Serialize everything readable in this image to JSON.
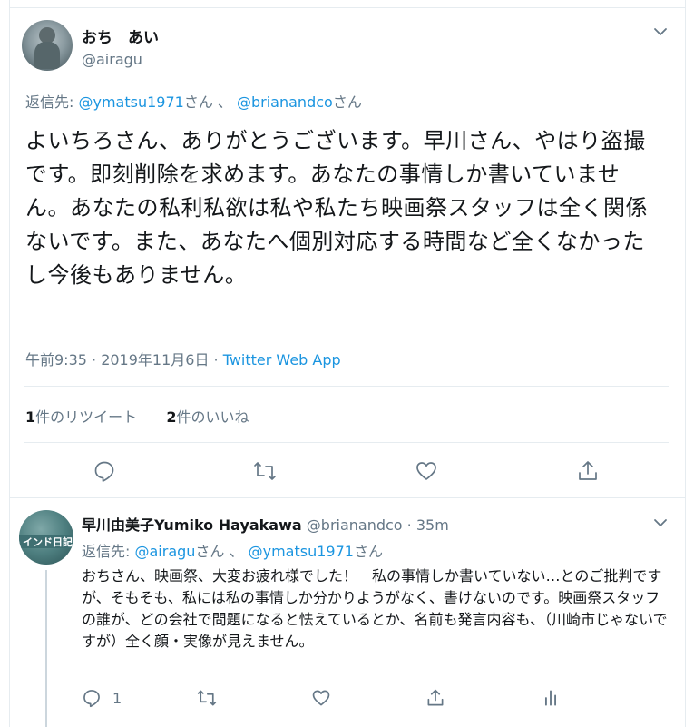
{
  "main_tweet": {
    "display_name": "おち　あい",
    "handle": "@airagu",
    "reply_prefix": "返信先: ",
    "reply_to_1": "@ymatsu1971",
    "reply_suffix_1": "さん 、 ",
    "reply_to_2": "@brianandco",
    "reply_suffix_2": "さん",
    "text": "よいちろさん、ありがとうございます。早川さん、やはり盗撮です。即刻削除を求めます。あなたの事情しか書いていません。あなたの私利私欲は私や私たち映画祭スタッフは全く関係ないです。また、あなたへ個別対応する時間など全くなかったし今後もありません。",
    "timestamp": "午前9:35 · 2019年11月6日 · ",
    "source": "Twitter Web App",
    "retweet_count": "1",
    "retweet_label": "件のリツイート",
    "like_count": "2",
    "like_label": "件のいいね",
    "icons": [
      "reply-icon",
      "retweet-icon",
      "like-icon",
      "share-icon",
      "chevron-down-icon"
    ]
  },
  "reply_tweet": {
    "display_name": "早川由美子Yumiko Hayakawa",
    "handle": "@brianandco",
    "time": " · 35m",
    "avatar_text": "インド日記",
    "reply_prefix": "返信先: ",
    "reply_to_1": "@airagu",
    "reply_suffix_1": "さん 、 ",
    "reply_to_2": "@ymatsu1971",
    "reply_suffix_2": "さん",
    "text": "おちさん、映画祭、大変お疲れ様でした！　私の事情しか書いていない…とのご批判ですが、そもそも、私には私の事情しか分かりようがなく、書けないのです。映画祭スタッフの誰が、どの会社で問題になると怯えているとか、名前も発言内容も、（川崎市じゃないですが）全く顔・実像が見えません。",
    "reply_count": "1",
    "icons": [
      "reply-icon",
      "retweet-icon",
      "like-icon",
      "share-icon",
      "analytics-icon",
      "chevron-down-icon"
    ]
  },
  "colors": {
    "link": "#1b95e0",
    "secondary_text": "#657786",
    "primary_text": "#14171a",
    "divider": "#e6ecf0"
  }
}
